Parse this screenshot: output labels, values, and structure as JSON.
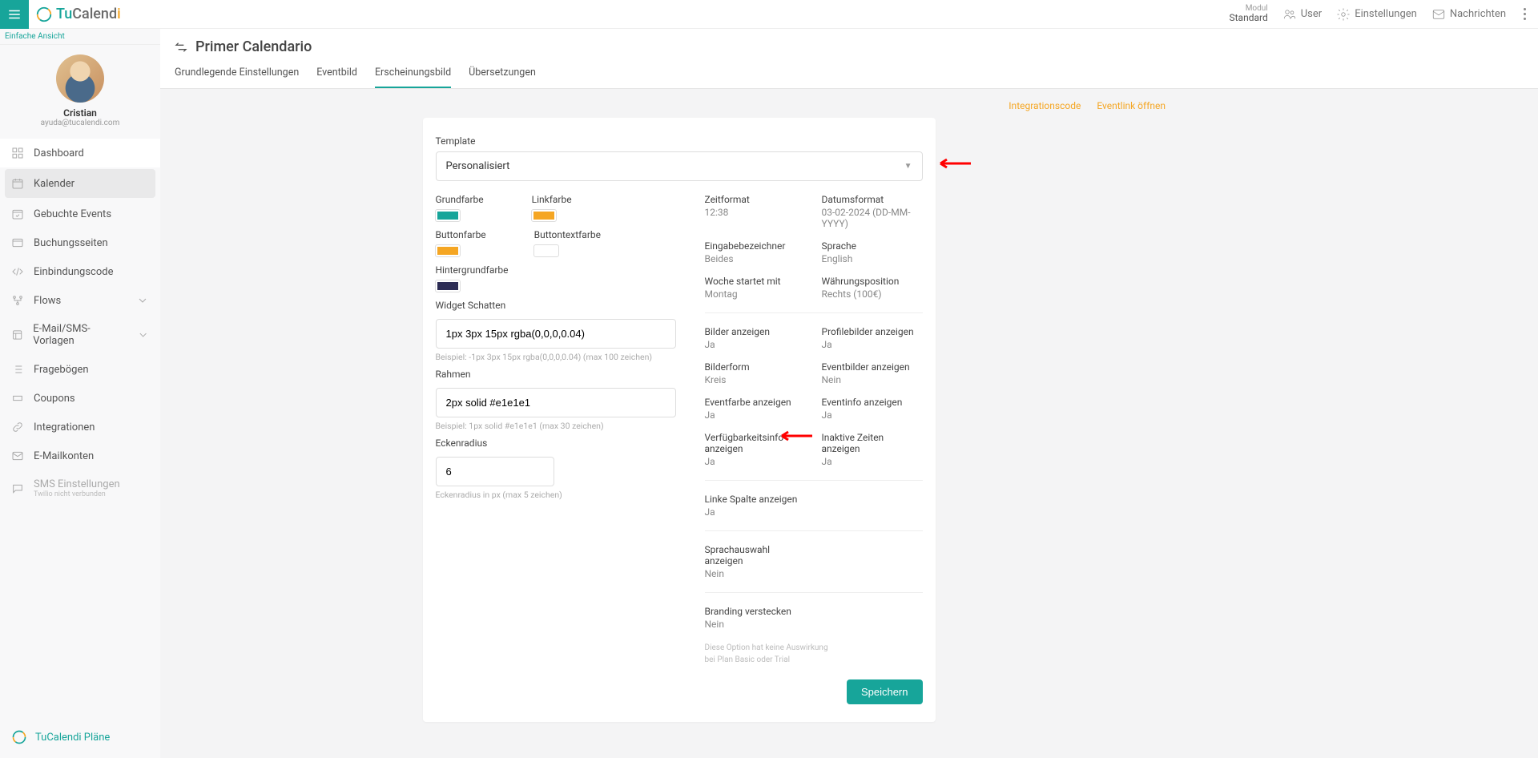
{
  "brand": {
    "tu": "Tu",
    "calend": "Calend",
    "i": "i"
  },
  "topbar": {
    "module_label": "Modul",
    "module_value": "Standard",
    "user": "User",
    "settings": "Einstellungen",
    "messages": "Nachrichten"
  },
  "sidebar": {
    "simple_view": "Einfache Ansicht",
    "profile_name": "Cristian",
    "profile_email": "ayuda@tucalendi.com",
    "items": [
      {
        "label": "Dashboard"
      },
      {
        "label": "Kalender"
      },
      {
        "label": "Gebuchte Events"
      },
      {
        "label": "Buchungsseiten"
      },
      {
        "label": "Einbindungscode"
      },
      {
        "label": "Flows"
      },
      {
        "label": "E-Mail/SMS-Vorlagen"
      },
      {
        "label": "Fragebögen"
      },
      {
        "label": "Coupons"
      },
      {
        "label": "Integrationen"
      },
      {
        "label": "E-Mailkonten"
      },
      {
        "label": "SMS Einstellungen",
        "sub": "Twilio nicht verbunden"
      }
    ],
    "plans": "TuCalendi Pläne"
  },
  "page": {
    "title": "Primer Calendario",
    "tabs": [
      "Grundlegende Einstellungen",
      "Eventbild",
      "Erscheinungsbild",
      "Übersetzungen"
    ],
    "links": {
      "integration": "Integrationscode",
      "open_event": "Eventlink öffnen"
    }
  },
  "form": {
    "template_label": "Template",
    "template_value": "Personalisiert",
    "colors": {
      "grundfarbe": "Grundfarbe",
      "linkfarbe": "Linkfarbe",
      "buttonfarbe": "Buttonfarbe",
      "buttontextfarbe": "Buttontextfarbe",
      "hintergrundfarbe": "Hintergrundfarbe",
      "c_grund": "#17a59a",
      "c_link": "#f5a623",
      "c_button": "#f5a623",
      "c_buttontext": "#ffffff",
      "c_hinter": "#2c2c54"
    },
    "shadow": {
      "label": "Widget Schatten",
      "value": "1px 3px 15px rgba(0,0,0,0.04)",
      "hint": "Beispiel: -1px 3px 15px rgba(0,0,0,0.04) (max 100 zeichen)"
    },
    "border": {
      "label": "Rahmen",
      "value": "2px solid #e1e1e1",
      "hint": "Beispiel: 1px solid #e1e1e1 (max 30 zeichen)"
    },
    "radius": {
      "label": "Eckenradius",
      "value": "6",
      "hint": "Eckenradius in px (max 5 zeichen)"
    },
    "info": [
      {
        "l": "Zeitformat",
        "v": "12:38"
      },
      {
        "l": "Datumsformat",
        "v": "03-02-2024 (DD-MM-YYYY)"
      },
      {
        "l": "Eingabebezeichner",
        "v": "Beides"
      },
      {
        "l": "Sprache",
        "v": "English"
      },
      {
        "l": "Woche startet mit",
        "v": "Montag"
      },
      {
        "l": "Währungsposition",
        "v": "Rechts (100€)"
      }
    ],
    "info2": [
      {
        "l": "Bilder anzeigen",
        "v": "Ja"
      },
      {
        "l": "Profilebilder anzeigen",
        "v": "Ja"
      },
      {
        "l": "Bilderform",
        "v": "Kreis"
      },
      {
        "l": "Eventbilder anzeigen",
        "v": "Nein"
      },
      {
        "l": "Eventfarbe anzeigen",
        "v": "Ja"
      },
      {
        "l": "Eventinfo anzeigen",
        "v": "Ja"
      },
      {
        "l": "Verfügbarkeitsinfo anzeigen",
        "v": "Ja"
      },
      {
        "l": "Inaktive Zeiten anzeigen",
        "v": "Ja"
      }
    ],
    "info3": [
      {
        "l": "Linke Spalte anzeigen",
        "v": "Ja"
      }
    ],
    "info4": [
      {
        "l": "Sprachauswahl anzeigen",
        "v": "Nein"
      }
    ],
    "info5": [
      {
        "l": "Branding verstecken",
        "v": "Nein"
      }
    ],
    "branding_note1": "Diese Option hat keine Auswirkung",
    "branding_note2": "bei Plan Basic oder Trial",
    "save": "Speichern"
  }
}
